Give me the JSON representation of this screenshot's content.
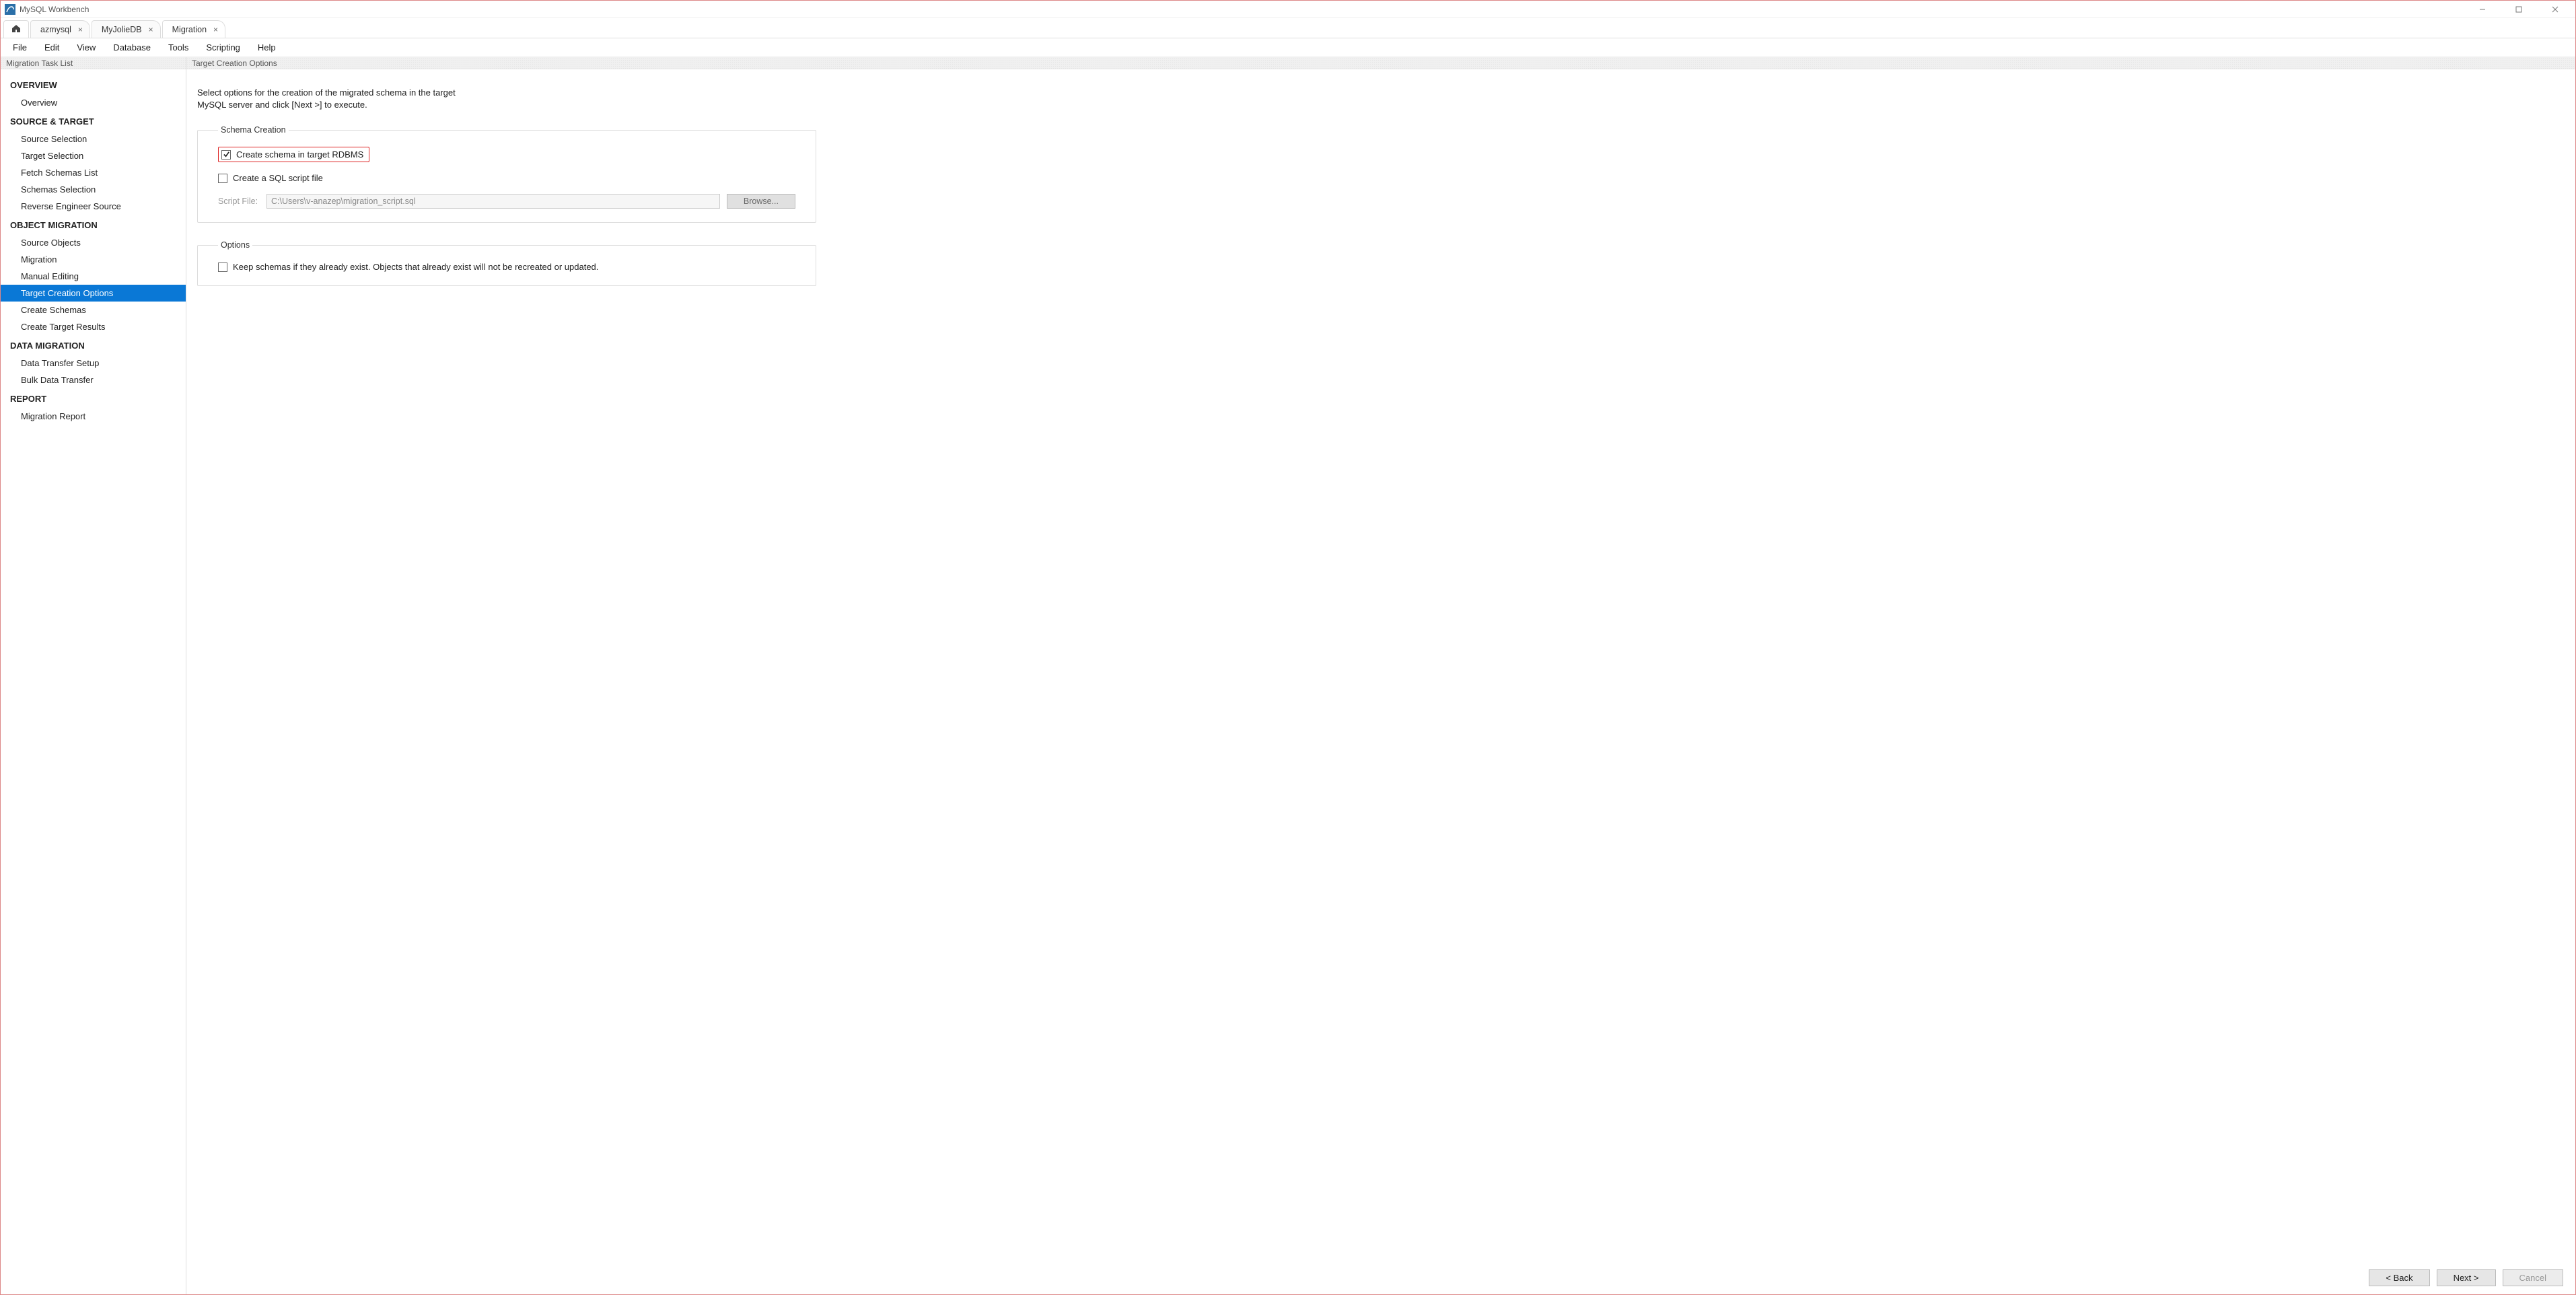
{
  "window": {
    "title": "MySQL Workbench"
  },
  "tabs": [
    {
      "label": "azmysql"
    },
    {
      "label": "MyJolieDB"
    },
    {
      "label": "Migration"
    }
  ],
  "menu": [
    "File",
    "Edit",
    "View",
    "Database",
    "Tools",
    "Scripting",
    "Help"
  ],
  "sidebar": {
    "header": "Migration Task List",
    "groups": [
      {
        "title": "OVERVIEW",
        "items": [
          "Overview"
        ]
      },
      {
        "title": "SOURCE & TARGET",
        "items": [
          "Source Selection",
          "Target Selection",
          "Fetch Schemas List",
          "Schemas Selection",
          "Reverse Engineer Source"
        ]
      },
      {
        "title": "OBJECT MIGRATION",
        "items": [
          "Source Objects",
          "Migration",
          "Manual Editing",
          "Target Creation Options",
          "Create Schemas",
          "Create Target Results"
        ]
      },
      {
        "title": "DATA MIGRATION",
        "items": [
          "Data Transfer Setup",
          "Bulk Data Transfer"
        ]
      },
      {
        "title": "REPORT",
        "items": [
          "Migration Report"
        ]
      }
    ],
    "selected": "Target Creation Options"
  },
  "main": {
    "header": "Target Creation Options",
    "instruction_line1": "Select options for the creation of the migrated schema in the target",
    "instruction_line2": "MySQL server and click [Next >] to execute.",
    "schema_creation": {
      "legend": "Schema Creation",
      "opt1_label": "Create schema in target RDBMS",
      "opt2_label": "Create a SQL script file",
      "script_label": "Script File:",
      "script_value": "C:\\Users\\v-anazep\\migration_script.sql",
      "browse_label": "Browse..."
    },
    "options": {
      "legend": "Options",
      "opt1_label": "Keep schemas if they already exist. Objects that already exist will not be recreated or updated."
    }
  },
  "footer": {
    "back": "< Back",
    "next": "Next >",
    "cancel": "Cancel"
  }
}
